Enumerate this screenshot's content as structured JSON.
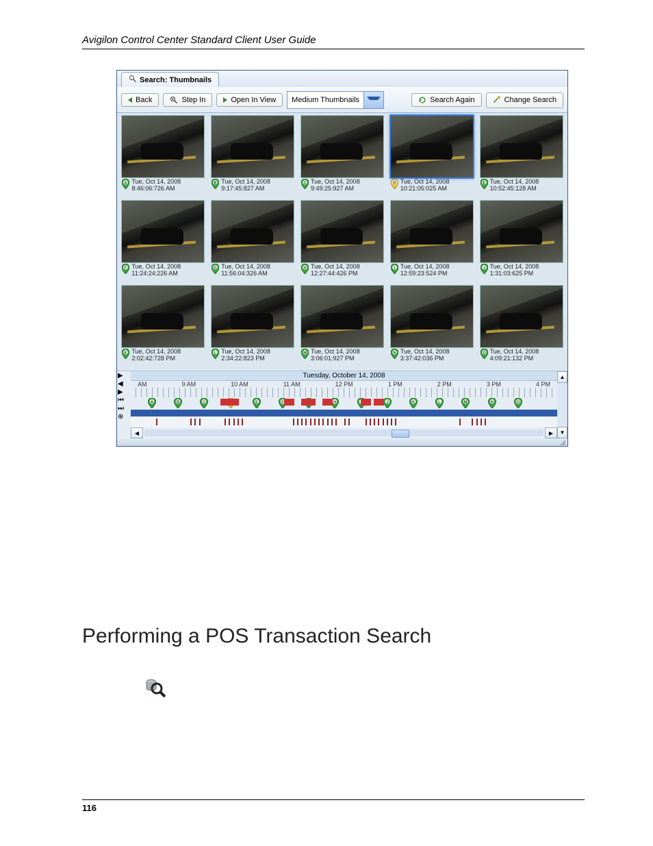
{
  "header": {
    "running_title": "Avigilon Control Center Standard Client User Guide"
  },
  "app": {
    "tab_label": "Search: Thumbnails",
    "toolbar": {
      "back": "Back",
      "step_in": "Step In",
      "open_in_view": "Open In View",
      "size_select": "Medium Thumbnails",
      "search_again": "Search Again",
      "change_search": "Change Search"
    },
    "thumbnails": [
      {
        "letter": "A",
        "date": "Tue, Oct 14, 2008",
        "time": "8:46:06:726 AM",
        "selected": false
      },
      {
        "letter": "B",
        "date": "Tue, Oct 14, 2008",
        "time": "9:17:45:827 AM",
        "selected": false
      },
      {
        "letter": "C",
        "date": "Tue, Oct 14, 2008",
        "time": "9:49:25:927 AM",
        "selected": false
      },
      {
        "letter": "D",
        "date": "Tue, Oct 14, 2008",
        "time": "10:21:05:025 AM",
        "selected": true
      },
      {
        "letter": "E",
        "date": "Tue, Oct 14, 2008",
        "time": "10:52:45:128 AM",
        "selected": false
      },
      {
        "letter": "F",
        "date": "Tue, Oct 14, 2008",
        "time": "11:24:24:226 AM",
        "selected": false
      },
      {
        "letter": "G",
        "date": "Tue, Oct 14, 2008",
        "time": "11:56:04:326 AM",
        "selected": false
      },
      {
        "letter": "H",
        "date": "Tue, Oct 14, 2008",
        "time": "12:27:44:426 PM",
        "selected": false
      },
      {
        "letter": "I",
        "date": "Tue, Oct 14, 2008",
        "time": "12:59:23:524 PM",
        "selected": false
      },
      {
        "letter": "J",
        "date": "Tue, Oct 14, 2008",
        "time": "1:31:03:625 PM",
        "selected": false
      },
      {
        "letter": "K",
        "date": "Tue, Oct 14, 2008",
        "time": "2:02:42:728 PM",
        "selected": false
      },
      {
        "letter": "L",
        "date": "Tue, Oct 14, 2008",
        "time": "2:34:22:823 PM",
        "selected": false
      },
      {
        "letter": "M",
        "date": "Tue, Oct 14, 2008",
        "time": "3:06:01:927 PM",
        "selected": false
      },
      {
        "letter": "N",
        "date": "Tue, Oct 14, 2008",
        "time": "3:37:42:036 PM",
        "selected": false
      },
      {
        "letter": "O",
        "date": "Tue, Oct 14, 2008",
        "time": "4:09:21:132 PM",
        "selected": false
      }
    ],
    "timeline": {
      "date_label": "Tuesday, October 14, 2008",
      "axis_start_label": "AM",
      "hours": [
        "9 AM",
        "10 AM",
        "11 AM",
        "12 PM",
        "1 PM",
        "2 PM",
        "3 PM",
        "4 PM"
      ],
      "markers": [
        "A",
        "B",
        "C",
        "D",
        "E",
        "F",
        "G",
        "H",
        "I",
        "J",
        "K",
        "L",
        "M",
        "N",
        "O"
      ]
    }
  },
  "section_heading": "Performing a POS Transaction Search",
  "page_number": "116"
}
